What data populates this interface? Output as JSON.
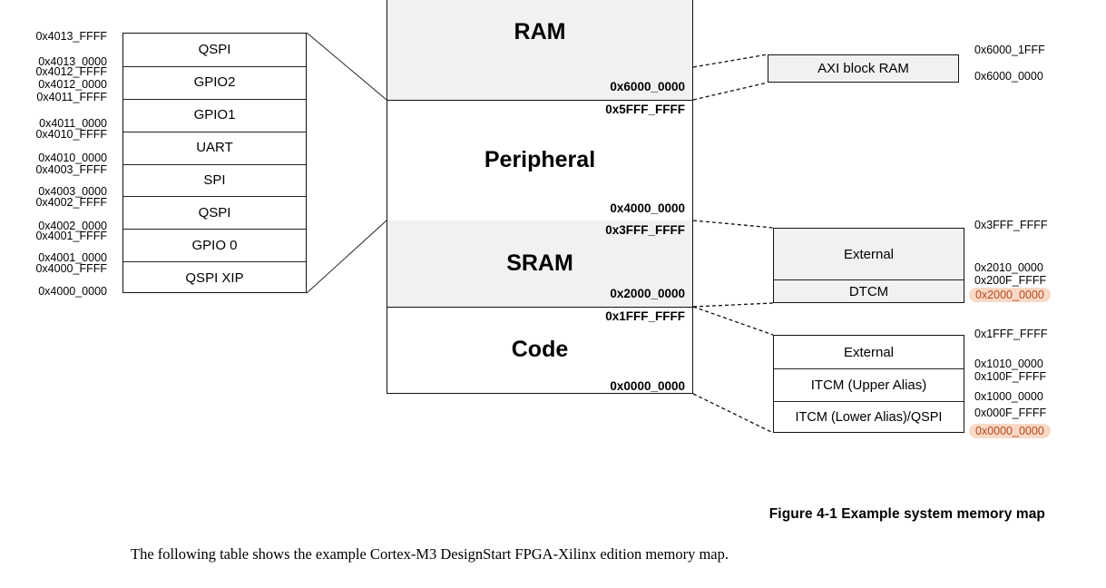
{
  "figure": {
    "caption": "Figure 4-1  Example system memory map",
    "body_text": "The following table shows the example Cortex-M3 DesignStart FPGA-Xilinx edition memory map.",
    "highlight_color": "#f9d9c6",
    "highlight_text_color": "#b4471c",
    "shaded_block_color": "#f1f1f1"
  },
  "peripheral_detail": {
    "rows": [
      {
        "label": "QSPI",
        "top_addr": "0x4013_FFFF",
        "bottom_addr": "0x4013_0000"
      },
      {
        "label": "GPIO2",
        "top_addr": "0x4012_FFFF",
        "bottom_addr": "0x4012_0000"
      },
      {
        "label": "GPIO1",
        "top_addr": "0x4011_FFFF",
        "bottom_addr": "0x4011_0000"
      },
      {
        "label": "UART",
        "top_addr": "0x4010_FFFF",
        "bottom_addr": "0x4010_0000"
      },
      {
        "label": "SPI",
        "top_addr": "0x4003_FFFF",
        "bottom_addr": "0x4003_0000"
      },
      {
        "label": "QSPI",
        "top_addr": "0x4002_FFFF",
        "bottom_addr": "0x4002_0000"
      },
      {
        "label": "GPIO 0",
        "top_addr": "0x4001_FFFF",
        "bottom_addr": "0x4001_0000"
      },
      {
        "label": "QSPI XIP",
        "top_addr": "0x4000_FFFF",
        "bottom_addr": "0x4000_0000"
      }
    ]
  },
  "main_map": {
    "segments": [
      {
        "name": "RAM",
        "shaded": true,
        "bottom_addr": "0x6000_0000"
      },
      {
        "name": "Peripheral",
        "shaded": false,
        "top_addr": "0x5FFF_FFFF",
        "bottom_addr": "0x4000_0000"
      },
      {
        "name": "SRAM",
        "shaded": true,
        "top_addr": "0x3FFF_FFFF",
        "bottom_addr": "0x2000_0000"
      },
      {
        "name": "Code",
        "shaded": false,
        "top_addr": "0x1FFF_FFFF",
        "bottom_addr": "0x0000_0000"
      }
    ]
  },
  "ram_detail": {
    "box_label": "AXI block RAM",
    "top_addr": "0x6000_1FFF",
    "bottom_addr": "0x6000_0000"
  },
  "sram_detail": {
    "rows": [
      {
        "label": "External"
      },
      {
        "label": "DTCM"
      }
    ],
    "addresses": [
      {
        "text": "0x3FFF_FFFF",
        "highlight": false
      },
      {
        "text": "0x2010_0000",
        "highlight": false
      },
      {
        "text": "0x200F_FFFF",
        "highlight": false
      },
      {
        "text": "0x2000_0000",
        "highlight": true
      }
    ]
  },
  "code_detail": {
    "rows": [
      {
        "label": "External"
      },
      {
        "label": "ITCM (Upper Alias)"
      },
      {
        "label": "ITCM (Lower Alias)/QSPI"
      }
    ],
    "addresses": [
      {
        "text": "0x1FFF_FFFF",
        "highlight": false
      },
      {
        "text": "0x1010_0000",
        "highlight": false
      },
      {
        "text": "0x100F_FFFF",
        "highlight": false
      },
      {
        "text": "0x1000_0000",
        "highlight": false
      },
      {
        "text": "0x000F_FFFF",
        "highlight": false
      },
      {
        "text": "0x0000_0000",
        "highlight": true
      }
    ]
  }
}
